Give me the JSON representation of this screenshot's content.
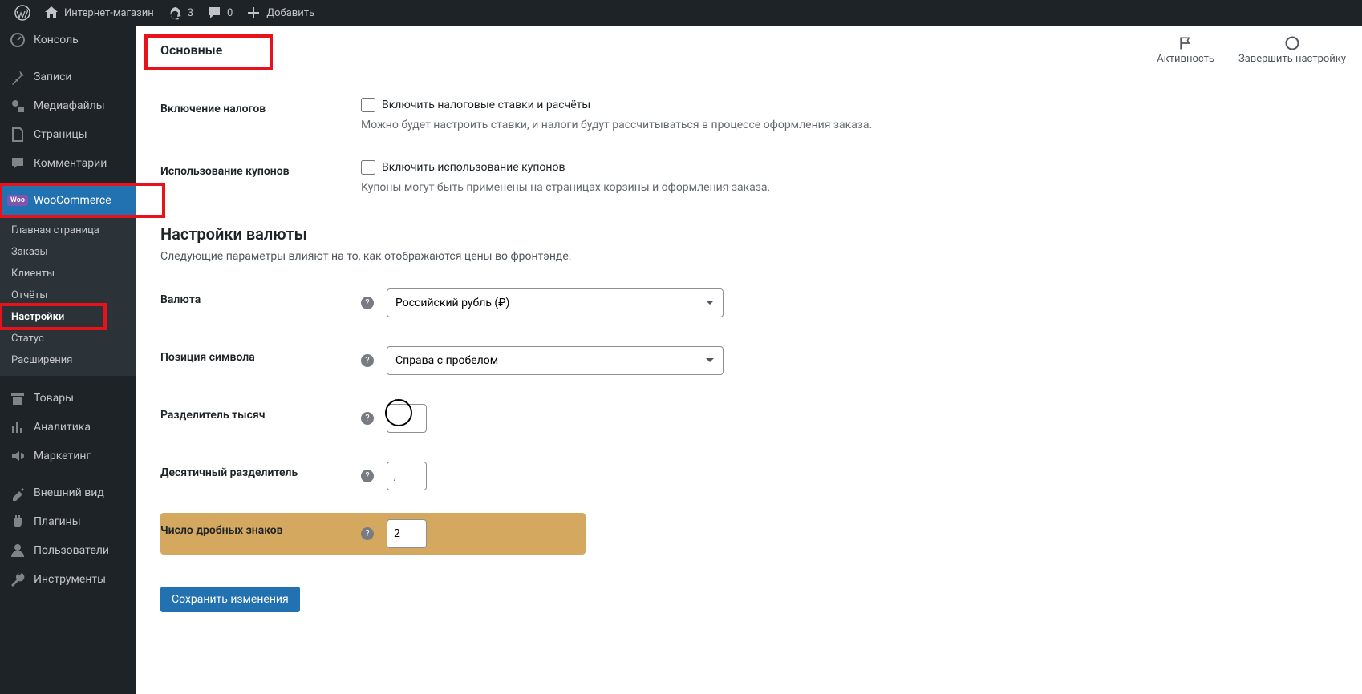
{
  "topbar": {
    "site_name": "Интернет-магазин",
    "updates": "3",
    "comments": "0",
    "add_new": "Добавить"
  },
  "sidebar": {
    "console": "Консоль",
    "posts": "Записи",
    "media": "Медиафайлы",
    "pages": "Страницы",
    "comments": "Комментарии",
    "woocommerce": "WooCommerce",
    "woo_sub": {
      "home": "Главная страница",
      "orders": "Заказы",
      "customers": "Клиенты",
      "reports": "Отчёты",
      "settings": "Настройки",
      "status": "Статус",
      "extensions": "Расширения"
    },
    "products": "Товары",
    "analytics": "Аналитика",
    "marketing": "Маркетинг",
    "appearance": "Внешний вид",
    "plugins": "Плагины",
    "users": "Пользователи",
    "tools": "Инструменты"
  },
  "tabs": {
    "general": "Основные"
  },
  "header_actions": {
    "activity": "Активность",
    "finish_setup": "Завершить настройку"
  },
  "settings": {
    "taxes_label": "Включение налогов",
    "taxes_checkbox": "Включить налоговые ставки и расчёты",
    "taxes_desc": "Можно будет настроить ставки, и налоги будут рассчитываться в процессе оформления заказа.",
    "coupons_label": "Использование купонов",
    "coupons_checkbox": "Включить использование купонов",
    "coupons_desc": "Купоны могут быть применены на страницах корзины и оформления заказа.",
    "currency_section_title": "Настройки валюты",
    "currency_section_desc": "Следующие параметры влияют на то, как отображаются цены во фронтэнде.",
    "currency_label": "Валюта",
    "currency_value": "Российский рубль (₽)",
    "position_label": "Позиция символа",
    "position_value": "Справа с пробелом",
    "thousand_sep_label": "Разделитель тысяч",
    "thousand_sep_value": "",
    "decimal_sep_label": "Десятичный разделитель",
    "decimal_sep_value": ",",
    "decimals_label": "Число дробных знаков",
    "decimals_value": "2",
    "save_button": "Сохранить изменения"
  }
}
